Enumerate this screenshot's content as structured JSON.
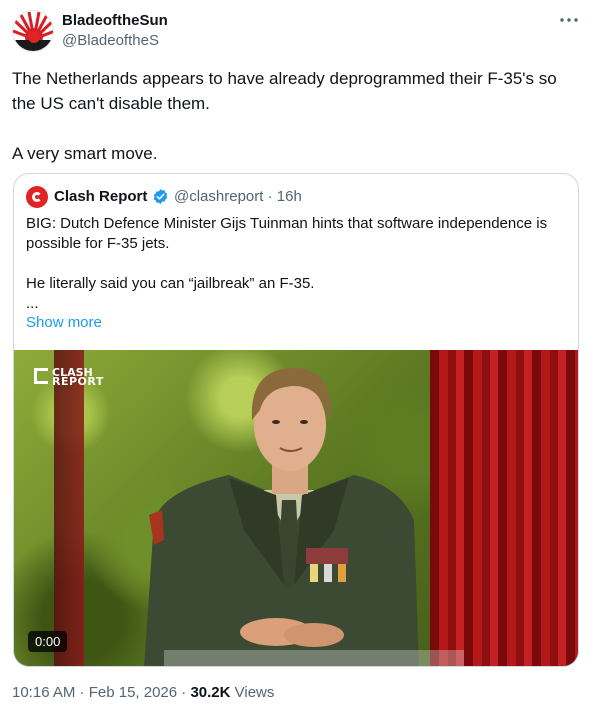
{
  "author": {
    "name": "BladeoftheSun",
    "handle": "@BladeoftheS",
    "more_icon": "more-icon"
  },
  "tweet": {
    "text": "The Netherlands appears to have already deprogrammed their F-35's so the US can't disable them.\n\nA very smart move."
  },
  "quote": {
    "name": "Clash Report",
    "handle_time": "@clashreport · 16h",
    "text": "BIG: Dutch Defence Minister Gijs Tuinman hints that software independence is possible for F-35 jets.\n\nHe literally said you can “jailbreak” an F-35.\n...",
    "show_more": "Show more",
    "media": {
      "watermark_line1": "CLASH",
      "watermark_line2": "REPORT",
      "timer": "0:00"
    }
  },
  "meta": {
    "time": "10:16 AM · Feb 15, 2026 · ",
    "views_count": "30.2K",
    "views_label": " Views"
  },
  "colors": {
    "link": "#1d9bf0",
    "muted": "#536471",
    "verified": "#1d9bf0",
    "brand_red": "#e02424"
  }
}
